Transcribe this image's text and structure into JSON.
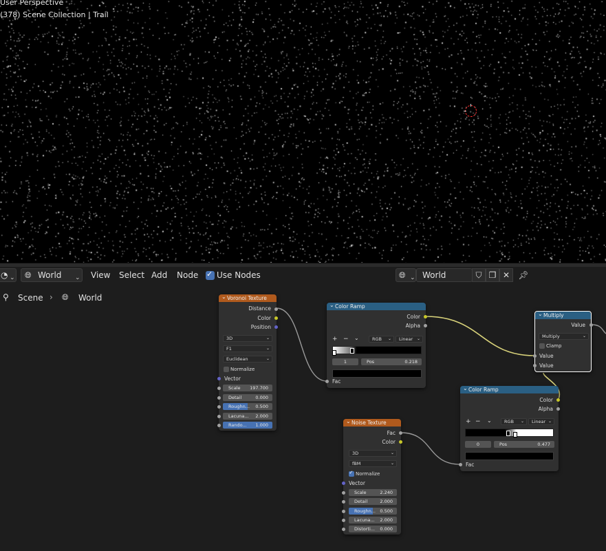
{
  "viewport": {
    "title": "User Perspective",
    "subtitle": "(378) Scene Collection | Trail"
  },
  "header": {
    "editor_icon": "node-editor-icon",
    "shader_type": "World",
    "menus": [
      "View",
      "Select",
      "Add",
      "Node"
    ],
    "use_nodes_label": "Use Nodes",
    "use_nodes_checked": true,
    "world_name": "World"
  },
  "breadcrumb": {
    "scene": "Scene",
    "separator": "›",
    "world": "World"
  },
  "nodes": {
    "voronoi": {
      "title": "Voronoi Texture",
      "outputs": [
        "Distance",
        "Color",
        "Position"
      ],
      "dimension": "3D",
      "feature": "F1",
      "metric": "Euclidean",
      "normalize_label": "Normalize",
      "normalize": false,
      "vector_label": "Vector",
      "fields": [
        {
          "label": "Scale",
          "value": "197.700"
        },
        {
          "label": "Detail",
          "value": "0.000"
        },
        {
          "label": "Roughn...",
          "value": "0.500",
          "fill": 0.5
        },
        {
          "label": "Lacuna...",
          "value": "2.000"
        },
        {
          "label": "Rando...",
          "value": "1.000",
          "fill": 1.0
        }
      ]
    },
    "ramp1": {
      "title": "Color Ramp",
      "outputs": [
        "Color",
        "Alpha"
      ],
      "mode": "RGB",
      "interp": "Linear",
      "stop_index": "1",
      "pos_label": "Pos",
      "pos_value": "0.218",
      "input": "Fac"
    },
    "noise": {
      "title": "Noise Texture",
      "outputs": [
        "Fac",
        "Color"
      ],
      "dimension": "3D",
      "type": "fBM",
      "normalize_label": "Normalize",
      "normalize": true,
      "vector_label": "Vector",
      "fields": [
        {
          "label": "Scale",
          "value": "2.240"
        },
        {
          "label": "Detail",
          "value": "2.000"
        },
        {
          "label": "Roughn...",
          "value": "0.500",
          "fill": 0.5
        },
        {
          "label": "Lacuna...",
          "value": "2.000"
        },
        {
          "label": "Distorti...",
          "value": "0.000"
        }
      ]
    },
    "ramp2": {
      "title": "Color Ramp",
      "outputs": [
        "Color",
        "Alpha"
      ],
      "mode": "RGB",
      "interp": "Linear",
      "stop_index": "0",
      "pos_label": "Pos",
      "pos_value": "0.477",
      "input": "Fac"
    },
    "multiply": {
      "title": "Multiply",
      "output": "Value",
      "operation": "Multiply",
      "clamp_label": "Clamp",
      "clamp": false,
      "inputs": [
        "Value",
        "Value"
      ]
    }
  },
  "colors": {
    "texture_header": "#b05a1d",
    "converter_header": "#2a5f83",
    "accent": "#4772b3"
  }
}
